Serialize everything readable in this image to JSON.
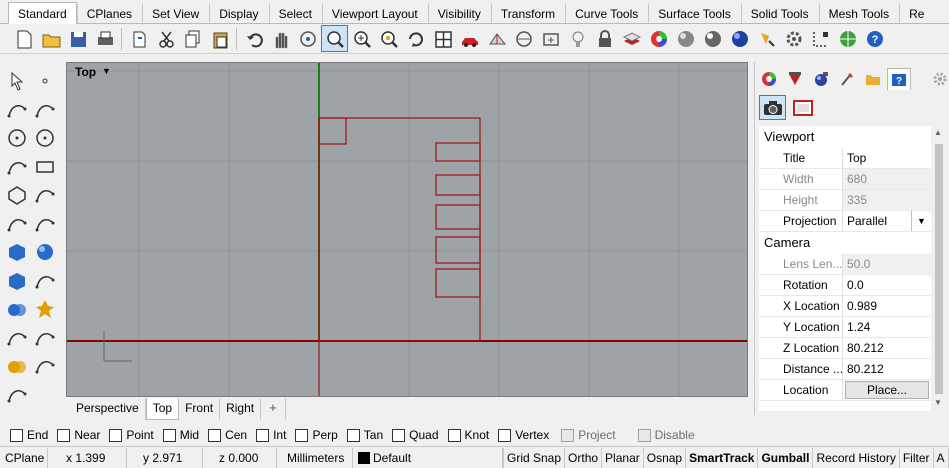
{
  "tabs": [
    "Standard",
    "CPlanes",
    "Set View",
    "Display",
    "Select",
    "Viewport Layout",
    "Visibility",
    "Transform",
    "Curve Tools",
    "Surface Tools",
    "Solid Tools",
    "Mesh Tools",
    "Re"
  ],
  "toolbar_icons": [
    "new-file-icon",
    "open-file-icon",
    "save-icon",
    "print-icon",
    "import-icon",
    "cut-icon",
    "copy-icon",
    "paste-icon",
    "undo-icon",
    "pan-hand-icon",
    "rotate-view-icon",
    "zoom-window-icon",
    "zoom-extents-icon",
    "zoom-selected-icon",
    "rotate-3d-icon",
    "four-viewports-icon",
    "car-icon",
    "grid-options-icon",
    "cplane-icon",
    "hide-object-icon",
    "light-bulb-icon",
    "lock-icon",
    "layer-icon",
    "color-wheel-icon",
    "material-sphere-icon",
    "render-sphere-icon",
    "render-blue-icon",
    "lamp-icon",
    "gear-options-icon",
    "dimension-icon",
    "globe-icon",
    "help-icon"
  ],
  "viewport": {
    "title": "Top",
    "dropdown": "▼",
    "tabs": [
      "Perspective",
      "Top",
      "Front",
      "Right"
    ],
    "active_tab": "Top",
    "add_tab": "+"
  },
  "panel": {
    "sections": {
      "viewport": "Viewport",
      "camera": "Camera"
    },
    "viewport_props": [
      {
        "label": "Title",
        "value": "Top",
        "disabled": false
      },
      {
        "label": "Width",
        "value": "680",
        "disabled": true
      },
      {
        "label": "Height",
        "value": "335",
        "disabled": true
      },
      {
        "label": "Projection",
        "value": "Parallel",
        "disabled": false,
        "dropdown": true
      }
    ],
    "camera_props": [
      {
        "label": "Lens Len...",
        "value": "50.0",
        "disabled": true
      },
      {
        "label": "Rotation",
        "value": "0.0",
        "disabled": false
      },
      {
        "label": "X Location",
        "value": "0.989",
        "disabled": false
      },
      {
        "label": "Y Location",
        "value": "1.24",
        "disabled": false
      },
      {
        "label": "Z Location",
        "value": "80.212",
        "disabled": false
      },
      {
        "label": "Distance ...",
        "value": "80.212",
        "disabled": false
      },
      {
        "label": "Location",
        "value": "Place...",
        "disabled": false,
        "button": true
      }
    ]
  },
  "osnap": [
    {
      "label": "End",
      "checked": false,
      "disabled": false
    },
    {
      "label": "Near",
      "checked": false,
      "disabled": false
    },
    {
      "label": "Point",
      "checked": false,
      "disabled": false
    },
    {
      "label": "Mid",
      "checked": false,
      "disabled": false
    },
    {
      "label": "Cen",
      "checked": false,
      "disabled": false
    },
    {
      "label": "Int",
      "checked": false,
      "disabled": false
    },
    {
      "label": "Perp",
      "checked": false,
      "disabled": false
    },
    {
      "label": "Tan",
      "checked": false,
      "disabled": false
    },
    {
      "label": "Quad",
      "checked": false,
      "disabled": false
    },
    {
      "label": "Knot",
      "checked": false,
      "disabled": false
    },
    {
      "label": "Vertex",
      "checked": false,
      "disabled": false
    },
    {
      "label": "Project",
      "checked": false,
      "disabled": true
    },
    {
      "label": "Disable",
      "checked": false,
      "disabled": true
    }
  ],
  "status": {
    "cplane": "CPlane",
    "x": "x 1.399",
    "y": "y 2.971",
    "z": "z 0.000",
    "units": "Millimeters",
    "layer": "Default",
    "toggles": [
      "Grid Snap",
      "Ortho",
      "Planar",
      "Osnap",
      "SmartTrack",
      "Gumball",
      "Record History",
      "Filter",
      "A"
    ]
  },
  "colors": {
    "viewport_bg": "#9ea3a8",
    "geometry": "#a01010",
    "x_axis": "#8b0000",
    "y_axis": "#006400",
    "active_accent": "#3c7fb1"
  }
}
